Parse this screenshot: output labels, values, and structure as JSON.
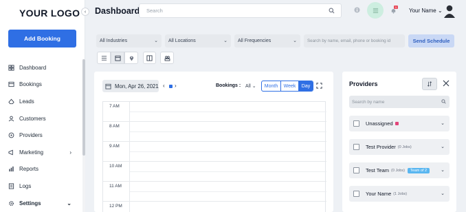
{
  "colors": {
    "accent": "#2f6fe4",
    "unassigned_marker": "#e2457a",
    "team_tag": "#59b6f0",
    "notification_badge": "#e74c5b"
  },
  "sidebar": {
    "logo": "YOUR LOGO",
    "add_booking": "Add Booking",
    "items": [
      {
        "label": "Dashboard",
        "icon": "dashboard-icon"
      },
      {
        "label": "Bookings",
        "icon": "bookings-icon"
      },
      {
        "label": "Leads",
        "icon": "leads-icon"
      },
      {
        "label": "Customers",
        "icon": "customers-icon"
      },
      {
        "label": "Providers",
        "icon": "providers-icon"
      },
      {
        "label": "Marketing",
        "icon": "marketing-icon",
        "chevron": "›"
      },
      {
        "label": "Reports",
        "icon": "reports-icon"
      },
      {
        "label": "Logs",
        "icon": "logs-icon"
      },
      {
        "label": "Settings",
        "icon": "settings-icon",
        "chevron": "⌄"
      }
    ]
  },
  "header": {
    "title": "Dashboard",
    "search_placeholder": "Search",
    "notification_count": "1",
    "user_name": "Your Name"
  },
  "filters": {
    "industries": "All Industries",
    "locations": "All Locations",
    "frequencies": "All Frequencies",
    "booking_search_placeholder": "Search by name, email, phone or booking id",
    "send_schedule": "Send Schedule"
  },
  "calendar": {
    "date": "Mon, Apr 26, 2021",
    "bookings_label": "Bookings :",
    "bookings_filter": "All",
    "views": [
      "Month",
      "Week",
      "Day"
    ],
    "active_view": "Day",
    "hours": [
      "7 AM",
      "8 AM",
      "9 AM",
      "10 AM",
      "11 AM",
      "12 PM"
    ]
  },
  "providers": {
    "title": "Providers",
    "search_placeholder": "Search by name",
    "rows": [
      {
        "name": "Unassigned",
        "jobs": "",
        "tag": ""
      },
      {
        "name": "Test Provider",
        "jobs": "(0 Jobs)",
        "tag": ""
      },
      {
        "name": "Test Team",
        "jobs": "(0 Jobs)",
        "tag": "Team of 2"
      },
      {
        "name": "Your Name",
        "jobs": "(1 Jobs)",
        "tag": ""
      }
    ]
  }
}
